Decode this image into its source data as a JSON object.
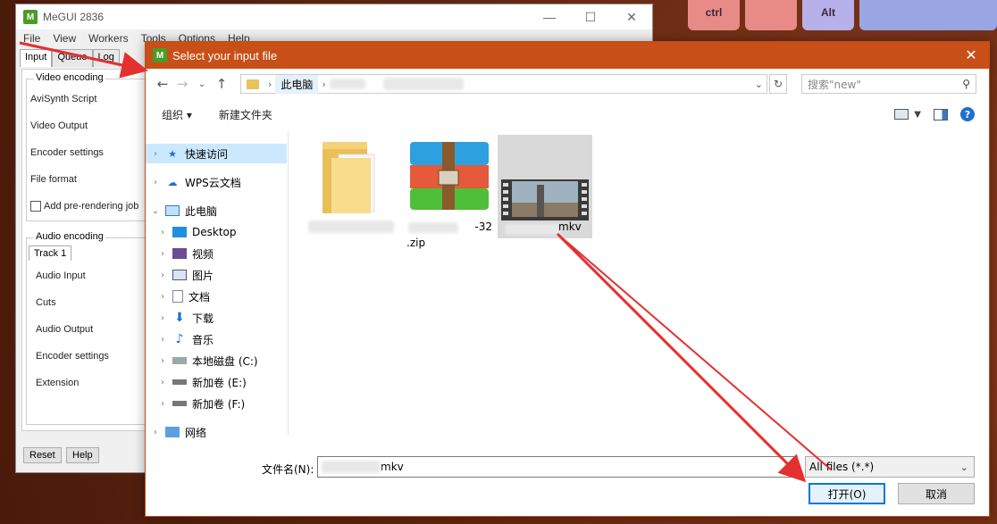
{
  "megui": {
    "title": "MeGUI 2836",
    "menu": [
      "File",
      "View",
      "Workers",
      "Tools",
      "Options",
      "Help"
    ],
    "tabs": [
      "Input",
      "Queue",
      "Log"
    ],
    "video_group": "Video encoding",
    "video_fields": [
      "AviSynth Script",
      "Video Output",
      "Encoder settings",
      "File format"
    ],
    "prerender": "Add pre-rendering job",
    "audio_group": "Audio encoding",
    "audio_tab": "Track 1",
    "audio_fields": [
      "Audio Input",
      "Cuts",
      "Audio Output",
      "Encoder settings",
      "Extension"
    ],
    "reset": "Reset",
    "help": "Help"
  },
  "desktop_keys": [
    "ctrl",
    "",
    "Alt",
    ""
  ],
  "dialog": {
    "title": "Select your input file",
    "breadcrumb": "此电脑",
    "search_placeholder": "搜索\"new\"",
    "organize": "组织 ▾",
    "new_folder": "新建文件夹",
    "nav": [
      {
        "label": "快速访问",
        "icon": "pin-icon",
        "expanded": false,
        "selected": true
      },
      {
        "label": "WPS云文档",
        "icon": "cloud-icon",
        "expanded": false,
        "selected": false
      },
      {
        "label": "此电脑",
        "icon": "computer-icon",
        "expanded": true,
        "selected": false
      },
      {
        "label": "Desktop",
        "icon": "desktop-icon",
        "expanded": false,
        "selected": false
      },
      {
        "label": "视频",
        "icon": "video-icon",
        "expanded": false,
        "selected": false
      },
      {
        "label": "图片",
        "icon": "pictures-icon",
        "expanded": false,
        "selected": false
      },
      {
        "label": "文档",
        "icon": "documents-icon",
        "expanded": false,
        "selected": false
      },
      {
        "label": "下载",
        "icon": "download-icon",
        "expanded": false,
        "selected": false
      },
      {
        "label": "音乐",
        "icon": "music-icon",
        "expanded": false,
        "selected": false
      },
      {
        "label": "本地磁盘 (C:)",
        "icon": "drive-icon",
        "expanded": false,
        "selected": false
      },
      {
        "label": "新加卷 (E:)",
        "icon": "drive-icon",
        "expanded": false,
        "selected": false
      },
      {
        "label": "新加卷 (F:)",
        "icon": "drive-icon",
        "expanded": false,
        "selected": false
      },
      {
        "label": "网络",
        "icon": "network-icon",
        "expanded": false,
        "selected": false
      }
    ],
    "files": [
      {
        "name": "",
        "type": "folder"
      },
      {
        "name": "-32",
        "name2": ".zip",
        "type": "archive"
      },
      {
        "name": "mkv",
        "type": "video"
      }
    ],
    "filename_label": "文件名(N):",
    "filename_value": "mkv",
    "filetype": "All files (*.*)",
    "open": "打开(O)",
    "cancel": "取消"
  }
}
